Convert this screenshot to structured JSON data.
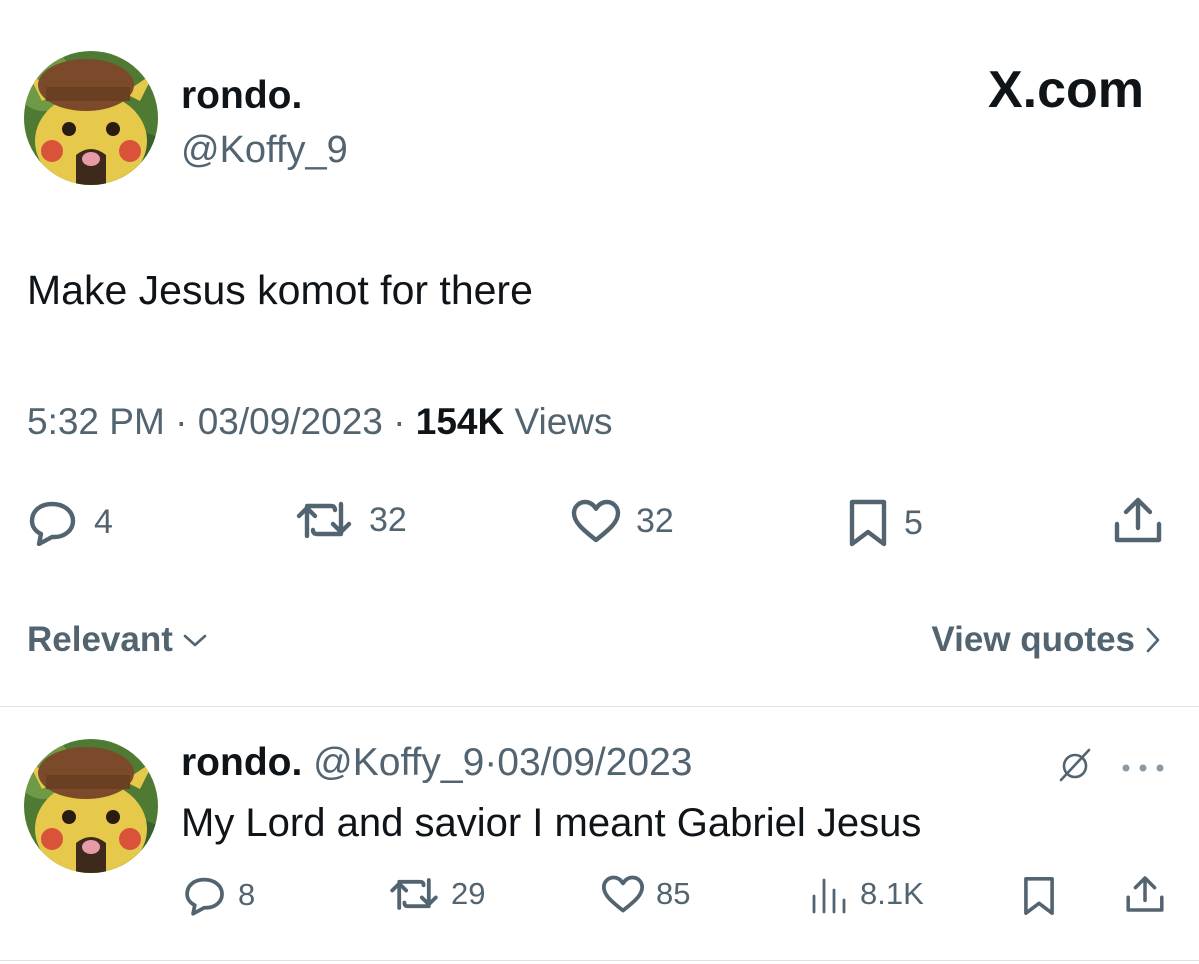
{
  "tweet": {
    "author_name": "rondo.",
    "author_handle": "@Koffy_9",
    "site_label": "X.com",
    "text": "Make Jesus komot for there",
    "time": "5:32 PM",
    "date": "03/09/2023",
    "views_count": "154K",
    "views_label": "Views",
    "stats": {
      "replies": "4",
      "reposts": "32",
      "likes": "32",
      "bookmarks": "5"
    }
  },
  "sort_bar": {
    "sort_label": "Relevant",
    "quotes_label": "View quotes"
  },
  "reply": {
    "author_name": "rondo.",
    "author_handle": "@Koffy_9",
    "separator": "·",
    "date": "03/09/2023",
    "text": "My Lord and savior I meant Gabriel Jesus",
    "stats": {
      "replies": "8",
      "reposts": "29",
      "likes": "85",
      "views": "8.1K"
    }
  },
  "colors": {
    "text": "#0f1419",
    "secondary": "#536471",
    "divider": "#dde3e8"
  },
  "icons": [
    "reply-icon",
    "repost-icon",
    "like-icon",
    "bookmark-icon",
    "share-icon",
    "chevron-down-icon",
    "chevron-right-icon",
    "views-icon",
    "grok-icon",
    "more-icon"
  ]
}
